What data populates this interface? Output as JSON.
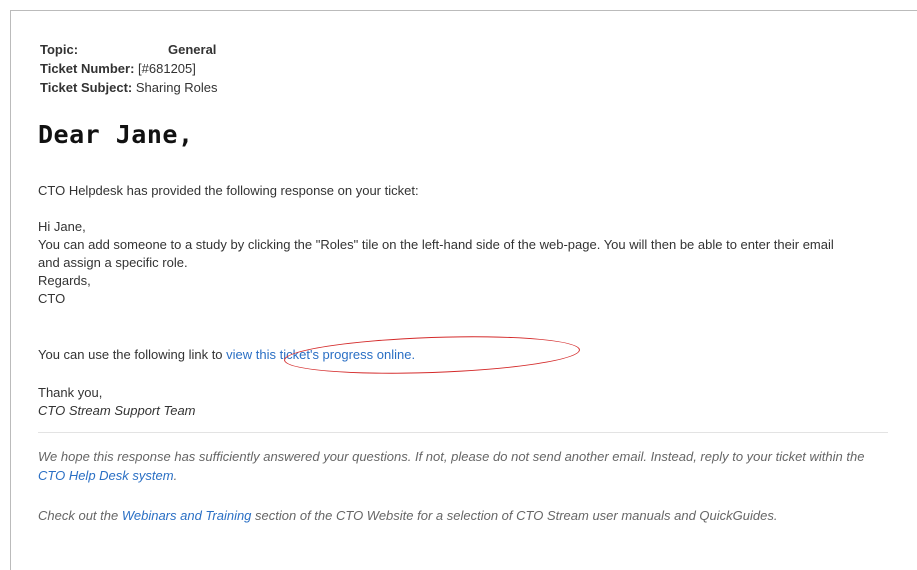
{
  "ticket": {
    "topic_label": "Topic:",
    "topic_value": "General",
    "number_label": "Ticket Number:",
    "number_value": "[#681205]",
    "subject_label": "Ticket Subject:",
    "subject_value": "Sharing Roles"
  },
  "greeting": "Dear Jane,",
  "intro": "CTO Helpdesk has provided the following response on your ticket:",
  "response": {
    "line1": "Hi Jane,",
    "line2": "You can add someone to a study by clicking the \"Roles\" tile on the left-hand side of the web-page. You will then be able to enter their email and assign a specific role.",
    "line3": "Regards,",
    "line4": "CTO"
  },
  "progress": {
    "prefix": "You can use the following link to ",
    "link_text": "view this ticket's progress online."
  },
  "signoff": {
    "thanks": "Thank you,",
    "team": "CTO Stream Support Team"
  },
  "footer": {
    "p1_pre": "We hope this response has sufficiently answered your questions. If not, please do not send another email. Instead, reply to your ticket within the ",
    "p1_link": "CTO Help Desk system",
    "p1_post": ".",
    "p2_pre": "Check out the ",
    "p2_link": "Webinars and Training",
    "p2_post": " section of the CTO Website for a selection of CTO Stream user manuals and QuickGuides."
  },
  "colors": {
    "link": "#2a6fc4",
    "annotation": "#d42a2a"
  }
}
